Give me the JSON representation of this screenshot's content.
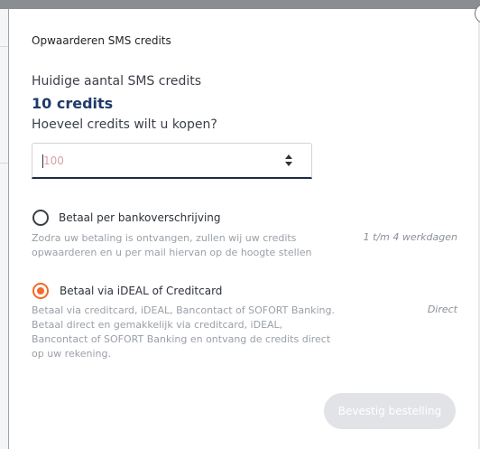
{
  "modal": {
    "title": "Opwaarderen SMS credits",
    "close_glyph": "×"
  },
  "credits": {
    "current_label": "Huidige aantal SMS credits",
    "current_value": "10 credits",
    "ask_label": "Hoeveel credits wilt u kopen?",
    "input_placeholder": "100",
    "input_value": ""
  },
  "payment_options": [
    {
      "label": "Betaal per bankoverschrijving",
      "description": "Zodra uw betaling is ontvangen, zullen wij uw credits opwaarderen en u per mail hiervan op de hoogte stellen",
      "time": "1 t/m 4 werkdagen",
      "selected": false
    },
    {
      "label": "Betaal via iDEAL of Creditcard",
      "description": "Betaal via creditcard, iDEAL, Bancontact of SOFORT Banking. Betaal direct en gemakkelijk via creditcard, iDEAL, Bancontact of SOFORT Banking en ontvang de credits direct op uw rekening.",
      "time": "Direct",
      "selected": true
    }
  ],
  "actions": {
    "confirm_label": "Bevestig bestelling",
    "confirm_disabled": true
  },
  "colors": {
    "accent": "#f26a2a",
    "heading": "#1f3a68",
    "button_disabled": "#e1e3e6"
  }
}
